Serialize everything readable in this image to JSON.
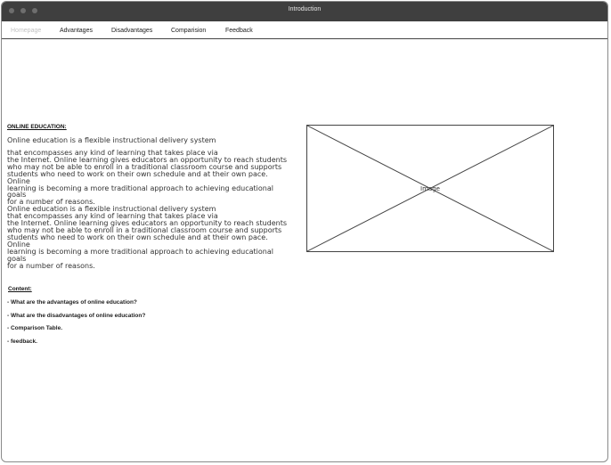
{
  "window": {
    "title": "Introduction"
  },
  "nav": {
    "items": [
      {
        "label": "Homepage",
        "disabled": true
      },
      {
        "label": "Advantages"
      },
      {
        "label": "Disadvantages"
      },
      {
        "label": "Comparision"
      },
      {
        "label": "Feedback"
      }
    ]
  },
  "main": {
    "heading": "ONLINE EDUCATION:",
    "intro": "Online education is a flexible instructional delivery system",
    "body": "that encompasses any kind of learning that takes place via\n the Internet. Online learning gives educators an opportunity to reach students\nwho may not be able to enroll in a traditional classroom course and supports\nstudents who need to work on their own schedule and at their own pace. Online\nlearning is becoming a more traditional approach to achieving educational goals\nfor a number of reasons.\nOnline education is a flexible instructional delivery system\nthat encompasses any kind of learning that takes place via\n the Internet. Online learning gives educators an opportunity to reach students\nwho may not be able to enroll in a traditional classroom course and supports\nstudents who need to work on their own schedule and at their own pace. Online\nlearning is becoming a more traditional approach to achieving educational goals\nfor a number of reasons.",
    "image_label": "Image",
    "content": {
      "heading": "Content:",
      "items": [
        "- What are the advantages of online education?",
        "- What are the disadvantages of online education?",
        "- Comparison Table.",
        "- feedback."
      ]
    }
  }
}
